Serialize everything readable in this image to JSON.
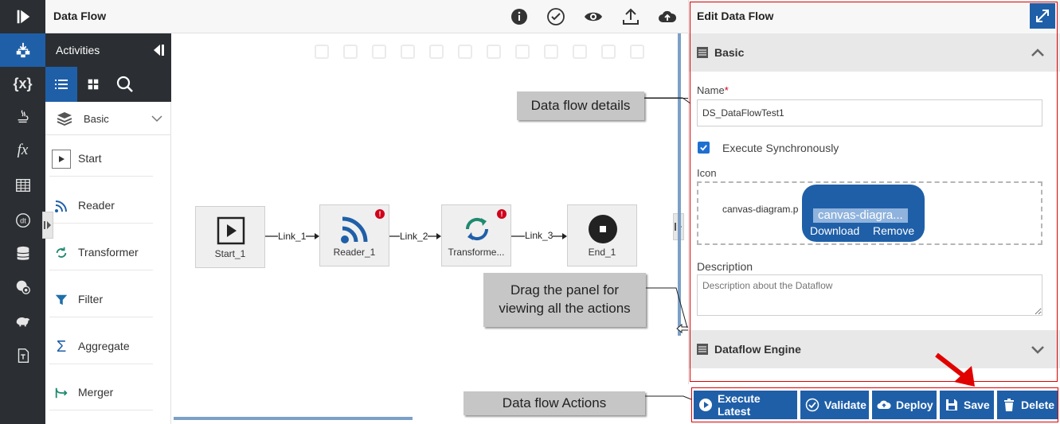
{
  "colors": {
    "accent": "#1f5fa8",
    "rail": "#2b2f33",
    "error": "#d0021b",
    "annotation": "#e00000"
  },
  "rail": {
    "items": [
      {
        "icon": "logo-play-icon"
      },
      {
        "icon": "data-flow-icon",
        "active": true
      },
      {
        "icon": "variables-icon",
        "label": "{x}"
      },
      {
        "icon": "java-icon"
      },
      {
        "icon": "function-icon",
        "label": "fx"
      },
      {
        "icon": "table-icon"
      },
      {
        "icon": "dt-icon",
        "label": "dt"
      },
      {
        "icon": "database-icon"
      },
      {
        "icon": "settings-globe-icon"
      },
      {
        "icon": "elephant-icon"
      },
      {
        "icon": "document-t-icon"
      }
    ]
  },
  "header": {
    "title": "Data Flow"
  },
  "activities": {
    "title": "Activities",
    "category": "Basic",
    "items": [
      {
        "label": "Start",
        "icon": "start-icon"
      },
      {
        "label": "Reader",
        "icon": "reader-icon"
      },
      {
        "label": "Transformer",
        "icon": "transformer-icon"
      },
      {
        "label": "Filter",
        "icon": "filter-icon"
      },
      {
        "label": "Aggregate",
        "icon": "aggregate-icon"
      },
      {
        "label": "Merger",
        "icon": "merger-icon"
      }
    ]
  },
  "canvas": {
    "nodes": [
      {
        "label": "Start_1",
        "icon": "play-icon",
        "error": false
      },
      {
        "label": "Reader_1",
        "icon": "rss-icon",
        "error": true
      },
      {
        "label": "Transforme...",
        "icon": "refresh-icon",
        "error": true
      },
      {
        "label": "End_1",
        "icon": "stop-icon",
        "error": false
      }
    ],
    "links": [
      "Link_1",
      "Link_2",
      "Link_3"
    ],
    "error_mark": "!"
  },
  "callouts": {
    "details": "Data flow details",
    "drag_line1": "Drag the panel for",
    "drag_line2": "viewing all the actions",
    "actions": "Data flow Actions"
  },
  "edit": {
    "title": "Edit Data Flow",
    "basic_section": "Basic",
    "name_label": "Name",
    "required_mark": "*",
    "name_value": "DS_DataFlowTest1",
    "execute_sync_label": "Execute Synchronously",
    "execute_sync_checked": true,
    "icon_label": "Icon",
    "file_name": "canvas-diagram.p",
    "file_popup_name": "canvas-diagra...",
    "download": "Download",
    "remove": "Remove",
    "description_label": "Description",
    "description_placeholder": "Description about the Dataflow",
    "engine_section": "Dataflow Engine"
  },
  "actions": {
    "execute": "Execute Latest",
    "validate": "Validate",
    "deploy": "Deploy",
    "save": "Save",
    "delete": "Delete"
  }
}
